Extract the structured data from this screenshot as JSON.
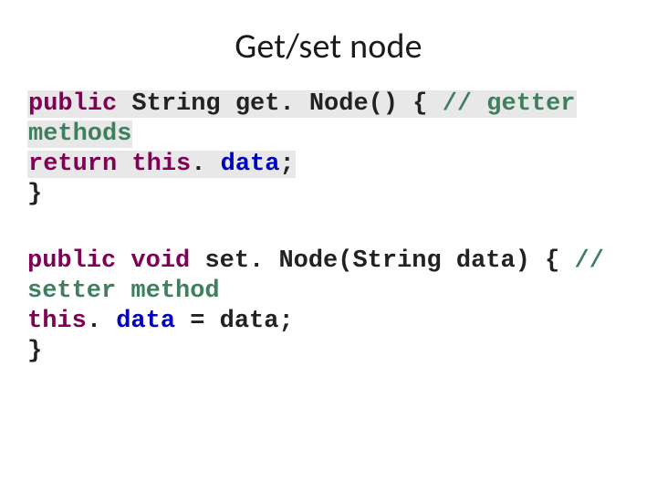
{
  "title": "Get/set node",
  "getter": {
    "l1": {
      "kw_public": "public",
      "sp1": " ",
      "type": "String",
      "sp2": " ",
      "fn": "get. Node()",
      "sp3": " ",
      "brace": "{",
      "sp4": " ",
      "comment": "// getter"
    },
    "l2": {
      "comment": "methods"
    },
    "l3": {
      "kw_return": "return",
      "sp1": " ",
      "kw_this": "this",
      "dot": ". ",
      "field": "data",
      "semi": ";"
    },
    "l4": {
      "brace": "}"
    }
  },
  "setter": {
    "l1": {
      "kw_public": "public",
      "sp1": " ",
      "kw_void": "void",
      "sp2": " ",
      "fn": "set. Node(String",
      "sp3": " ",
      "arg": "data",
      "paren": ")",
      "sp4": " ",
      "brace": "{",
      "sp5": " ",
      "comment": "//"
    },
    "l2": {
      "comment": "setter method"
    },
    "l3": {
      "kw_this": "this",
      "dot": ". ",
      "field": "data",
      "sp1": " ",
      "eq": "=",
      "sp2": " ",
      "rhs": "data;"
    },
    "l4": {
      "brace": "}"
    }
  }
}
